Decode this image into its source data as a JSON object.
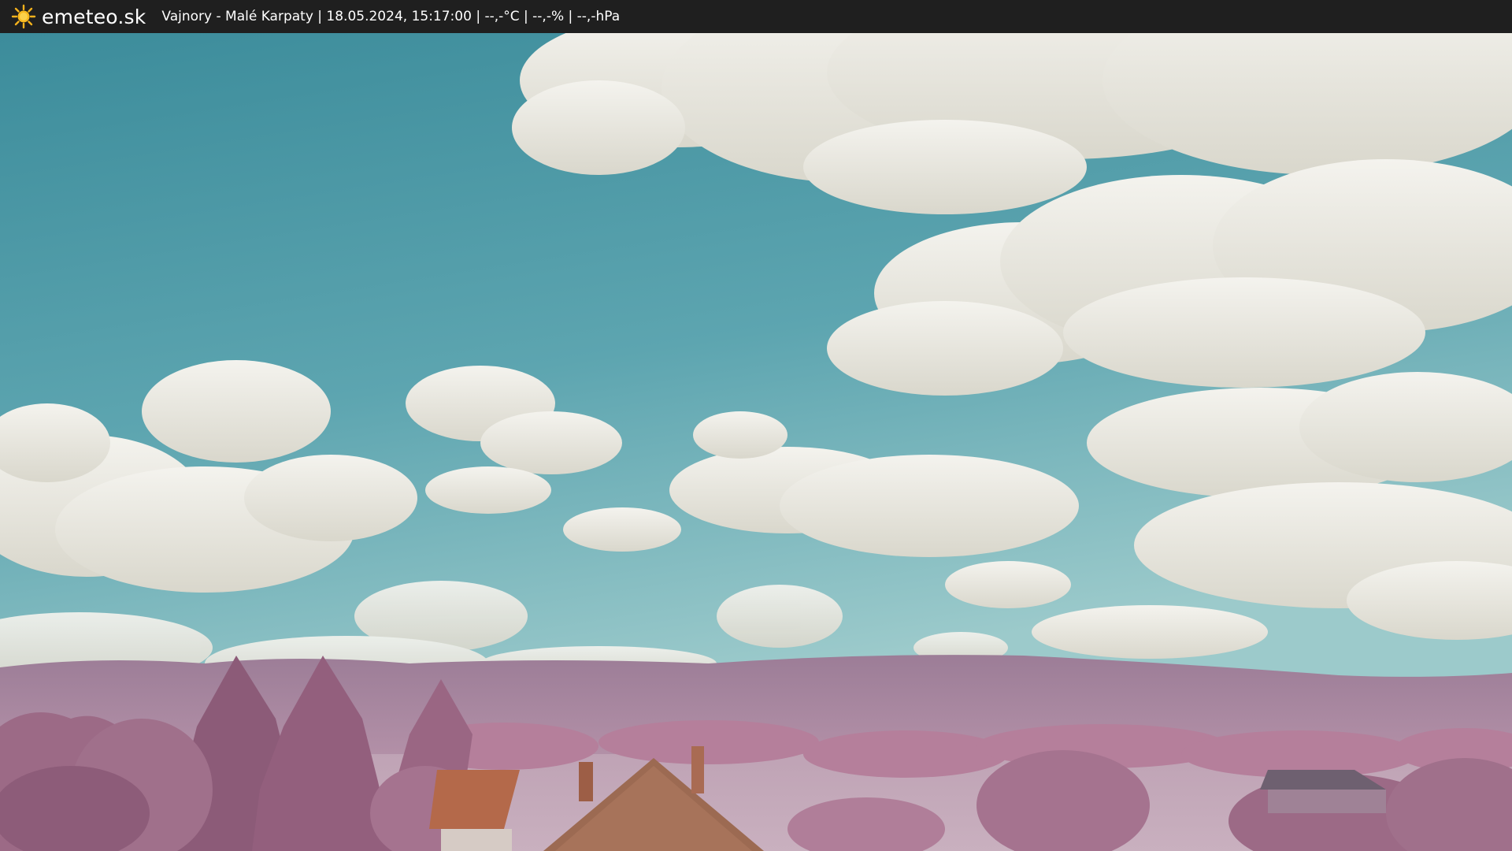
{
  "header": {
    "brand": "emeteo.sk",
    "caption": "Vajnory - Malé Karpaty | 18.05.2024, 15:17:00 | --,-°C | --,-% | --,-hPa",
    "logo_icon": "sun-icon",
    "logo_color": "#f5b21c"
  },
  "scene": {
    "sky_top": "#3f8f9d",
    "sky_bottom": "#8fc3c6",
    "cloud": "#ecebe4",
    "foliage": "#a8738f",
    "hills": "#a2839b",
    "roof": "#b4694a"
  }
}
